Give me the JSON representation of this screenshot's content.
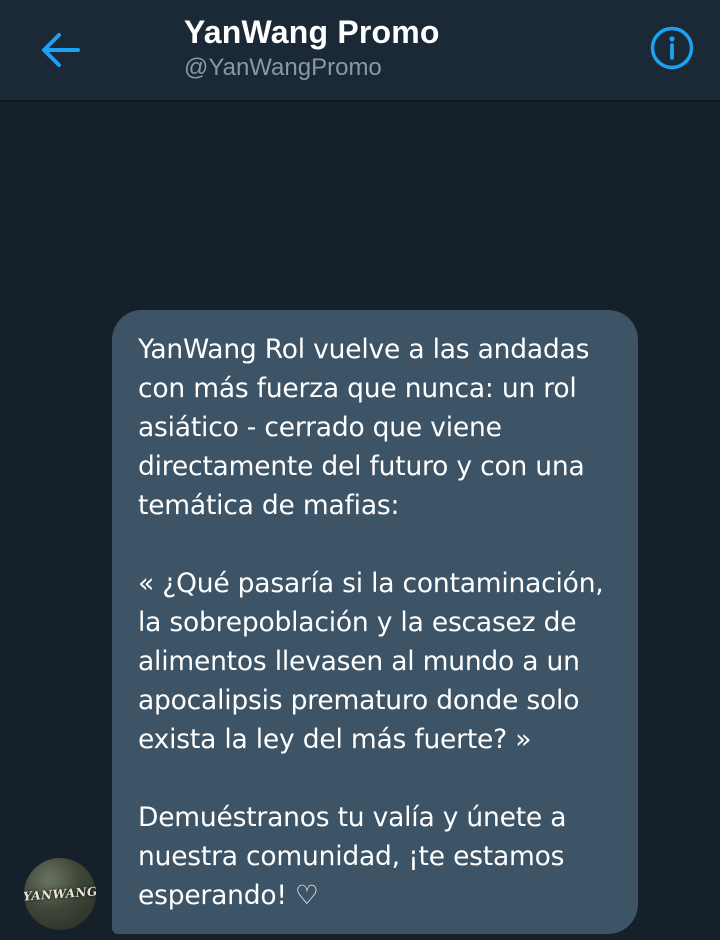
{
  "header": {
    "title": "YanWang Promo",
    "handle": "@YanWangPromo",
    "back_icon": "arrow-left-icon",
    "info_icon": "info-icon",
    "accent_color": "#1da1f2"
  },
  "conversation": {
    "avatar_text": "YANWANG",
    "message": {
      "text": "YanWang Rol vuelve a las andadas\ncon más fuerza que nunca: un rol\nasiático - cerrado que viene\ndirectamente del futuro y con una\ntemática de mafias:\n\n« ¿Qué pasaría si la contaminación,\nla sobrepoblación y la escasez de\nalimentos llevasen al mundo a un\napocalipsis prematuro donde solo\nexista la ley del más fuerte? »\n\nDemuéstranos tu valía y únete a\nnuestra comunidad, ¡te estamos\nesperando! ♡"
    }
  },
  "colors": {
    "background": "#15202b",
    "header_background": "#1b2836",
    "bubble_background": "#3d5466",
    "secondary_text": "#8899a6"
  }
}
